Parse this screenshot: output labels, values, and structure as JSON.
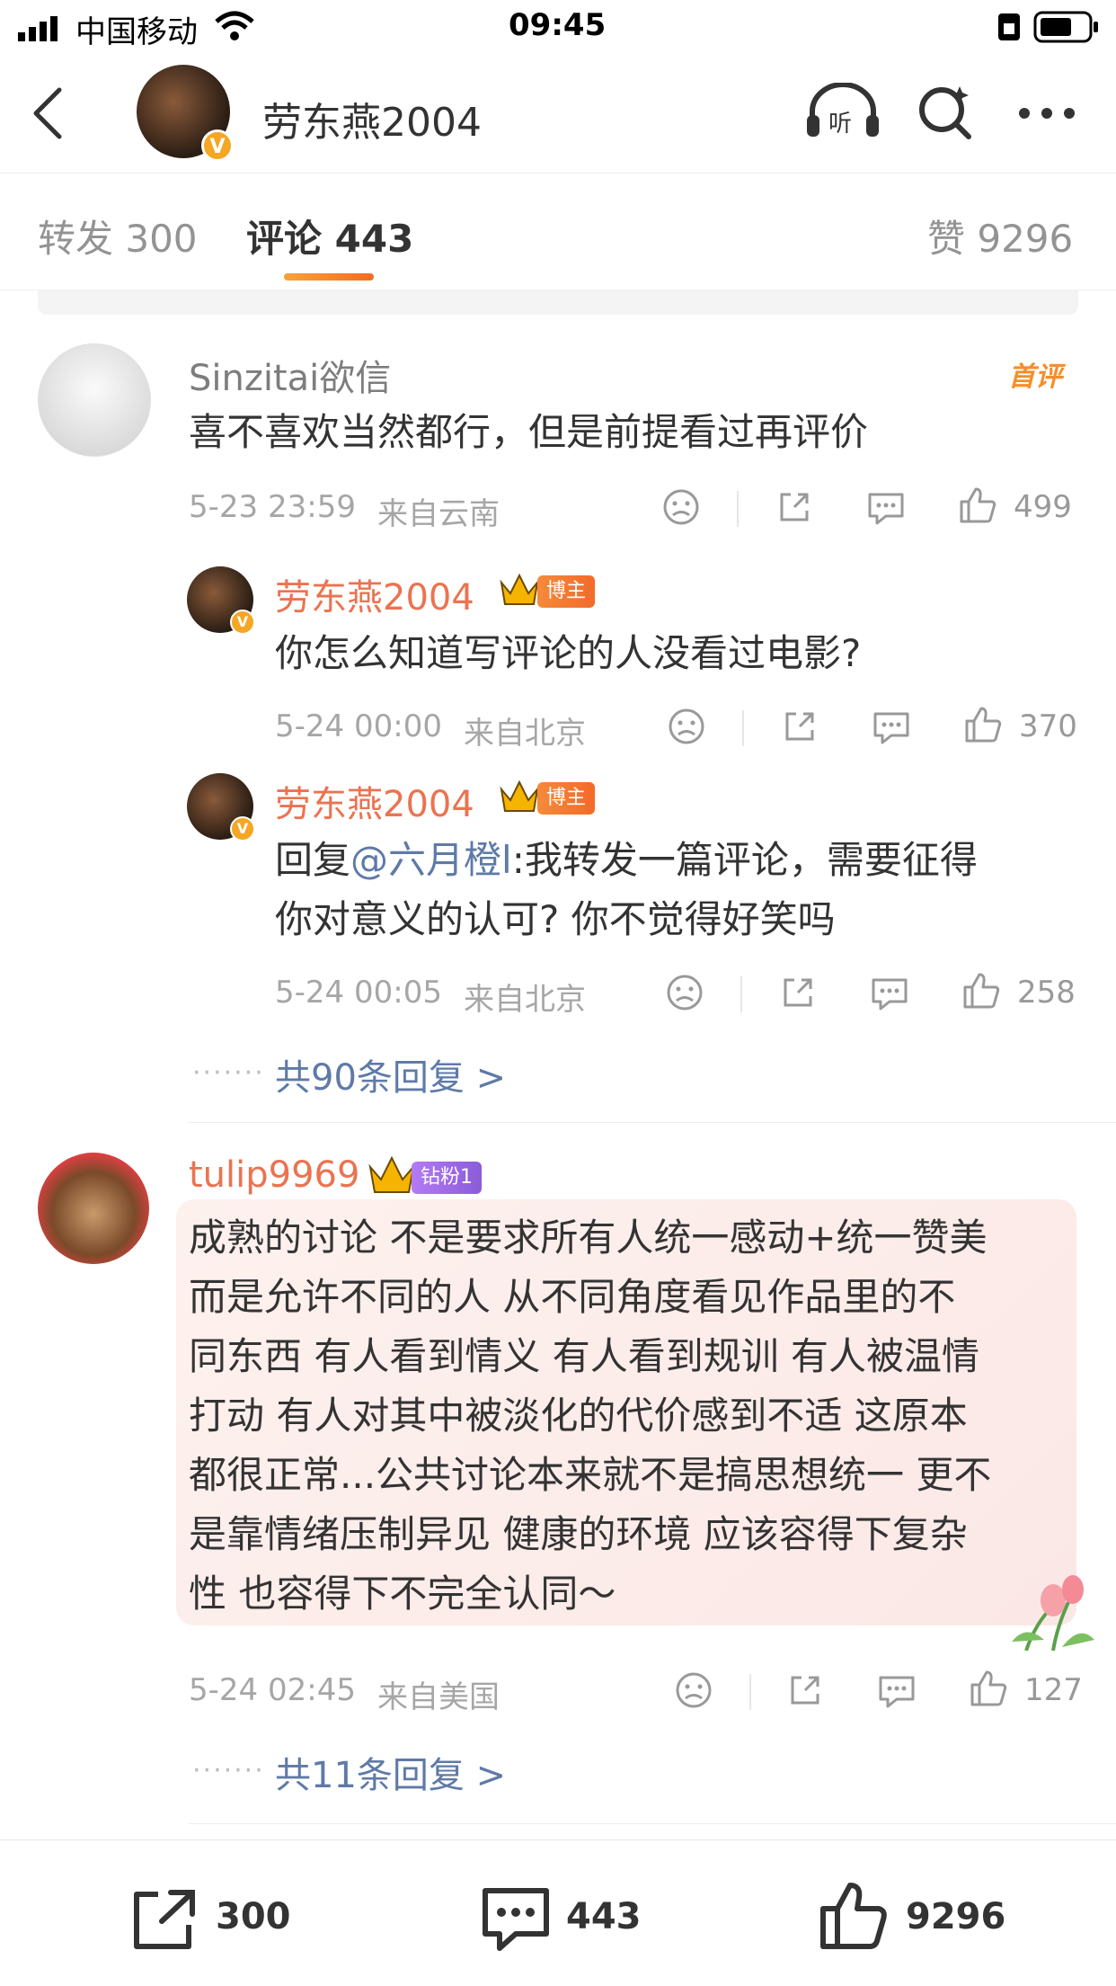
{
  "status_bar": {
    "carrier": "中国移动",
    "time": "09:45"
  },
  "header": {
    "username": "劳东燕2004",
    "verified_badge": "V"
  },
  "tabs": {
    "repost": "转发 300",
    "comments": "评论 443",
    "likes": "赞 9296"
  },
  "comments": [
    {
      "user": "Sinzitai欲信",
      "badge": "首评",
      "text": "喜不喜欢当然都行，但是前提看过再评价",
      "time": "5-23 23:59",
      "location": "来自云南",
      "likes": "499",
      "replies": [
        {
          "user": "劳东燕2004",
          "tag": "博主",
          "text": "你怎么知道写评论的人没看过电影?",
          "time": "5-24 00:00",
          "location": "来自北京",
          "likes": "370"
        },
        {
          "user": "劳东燕2004",
          "tag": "博主",
          "text_prefix": "回复",
          "mention": "@六月橙l",
          "text_line1": ":我转发一篇评论，需要征得",
          "text_line2": "你对意义的认可? 你不觉得好笑吗",
          "time": "5-24 00:05",
          "location": "来自北京",
          "likes": "258"
        }
      ],
      "more_replies": "共90条回复 >"
    },
    {
      "user": "tulip9969",
      "tag": "钻粉1",
      "text_lines": [
        "成熟的讨论 不是要求所有人统一感动+统一赞美",
        "而是允许不同的人 从不同角度看见作品里的不",
        "同东西 有人看到情义 有人看到规训 有人被温情",
        "打动 有人对其中被淡化的代价感到不适 这原本",
        "都很正常...公共讨论本来就不是搞思想统一 更不",
        "是靠情绪压制异见 健康的环境 应该容得下复杂",
        "性 也容得下不完全认同～"
      ],
      "time": "5-24 02:45",
      "location": "来自美国",
      "likes": "127",
      "more_replies": "共11条回复 >"
    }
  ],
  "footer": {
    "reposts": "300",
    "comments": "443",
    "likes": "9296"
  },
  "colors": {
    "accent": "#f46c1f",
    "username_orange": "#eb7350",
    "link_blue": "#5f7aa7"
  },
  "icons": [
    "signal-icon",
    "wifi-icon",
    "battery-icon",
    "back-icon",
    "listen-icon",
    "search-icon",
    "more-icon",
    "dislike-icon",
    "share-icon",
    "comment-icon",
    "like-icon"
  ]
}
